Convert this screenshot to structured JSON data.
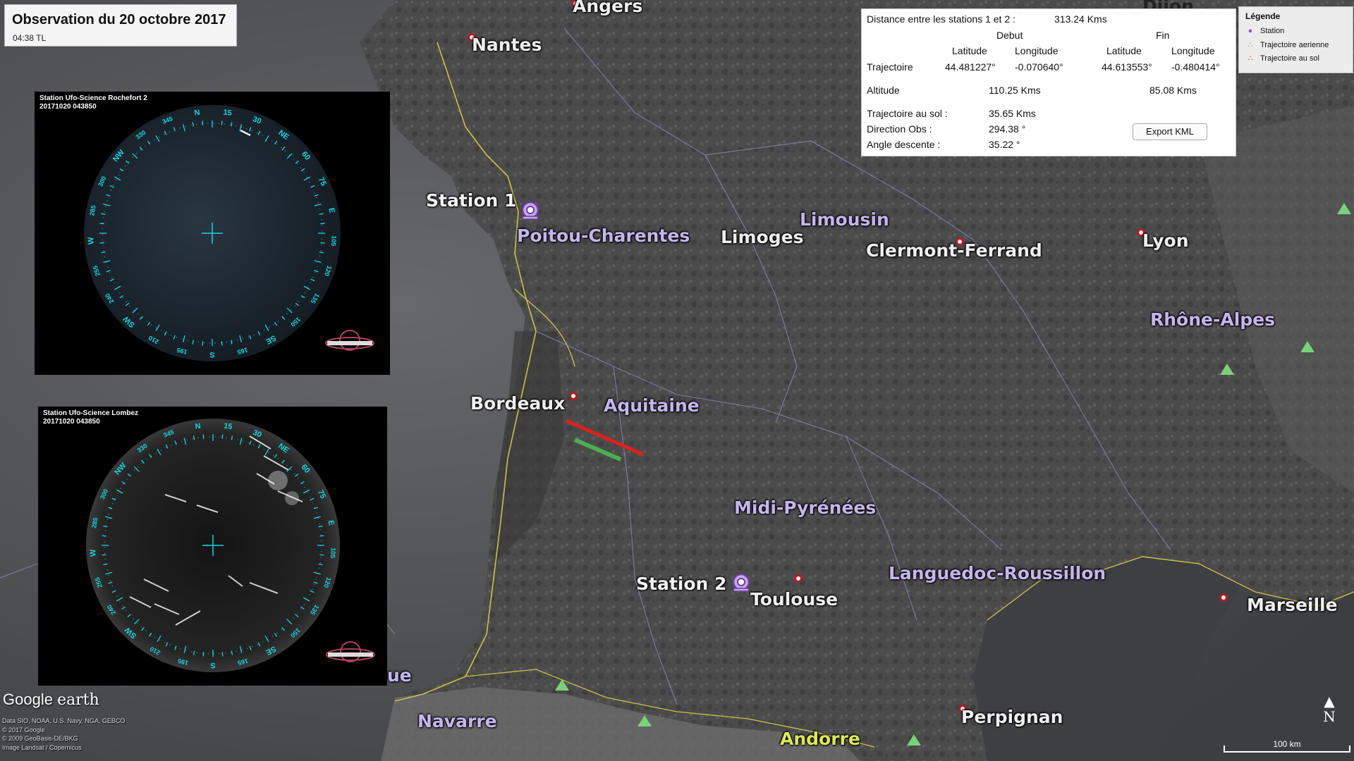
{
  "title": {
    "main": "Observation du 20 octobre 2017",
    "time": "04:38 TL"
  },
  "cameras": [
    {
      "name": "Station Ufo-Science Rochefort 2",
      "timestamp": "20171020 043850"
    },
    {
      "name": "Station Ufo-Science Lombez",
      "timestamp": "20171020 043850"
    }
  ],
  "compass_labels": [
    "S",
    "165",
    "SE",
    "150",
    "135",
    "120",
    "105",
    "E",
    "75",
    "60",
    "NE",
    "30",
    "15",
    "N",
    "345",
    "330",
    "NW",
    "300",
    "285",
    "W",
    "255",
    "240",
    "SW",
    "210",
    "195"
  ],
  "info": {
    "distance_label": "Distance entre les stations 1 et 2 :",
    "distance_value": "313.24 Kms",
    "debut": "Debut",
    "fin": "Fin",
    "latitude": "Latitude",
    "longitude": "Longitude",
    "trajectoire": "Trajectoire",
    "start_lat": "44.481227°",
    "start_lon": "-0.070640°",
    "end_lat": "44.613553°",
    "end_lon": "-0.480414°",
    "altitude_label": "Altitude",
    "alt_start": "110.25 Kms",
    "alt_end": "85.08 Kms",
    "ground_label": "Trajectoire au sol :",
    "ground_value": "35.65 Kms",
    "direction_label": "Direction Obs :",
    "direction_value": "294.38 °",
    "angle_label": "Angle descente :",
    "angle_value": "35.22 °",
    "export": "Export KML"
  },
  "legend": {
    "title": "Légende",
    "items": [
      "Station",
      "Trajectoire aerienne",
      "Trajectoire au sol"
    ]
  },
  "places": {
    "angers": "Angers",
    "nantes": "Nantes",
    "dijon": "Dijon",
    "station1": "Station 1",
    "poitou": "Poitou-Charentes",
    "limoges": "Limoges",
    "limousin": "Limousin",
    "clermont": "Clermont-Ferrand",
    "lyon": "Lyon",
    "rhone": "Rhône-Alpes",
    "bordeaux": "Bordeaux",
    "aquitaine": "Aquitaine",
    "midi": "Midi-Pyrénées",
    "station2": "Station 2",
    "toulouse": "Toulouse",
    "languedoc": "Languedoc-Roussillon",
    "marseille": "Marseille",
    "navarre": "Navarre",
    "andorre": "Andorre",
    "perpignan": "Perpignan",
    "ue": "ue"
  },
  "footer": {
    "logo_google": "Google",
    "logo_earth": "earth",
    "credits": [
      "Data SIO, NOAA, U.S. Navy, NGA, GEBCO",
      "© 2017 Google",
      "© 2009 GeoBasis-DE/BKG",
      "Image Landsat / Copernicus"
    ],
    "north": "N",
    "scale": "100 km"
  },
  "colors": {
    "region": "#c3b6ee",
    "air_track": "#e0201c",
    "ground_track": "#4caf50",
    "compass": "#19d4e0"
  }
}
